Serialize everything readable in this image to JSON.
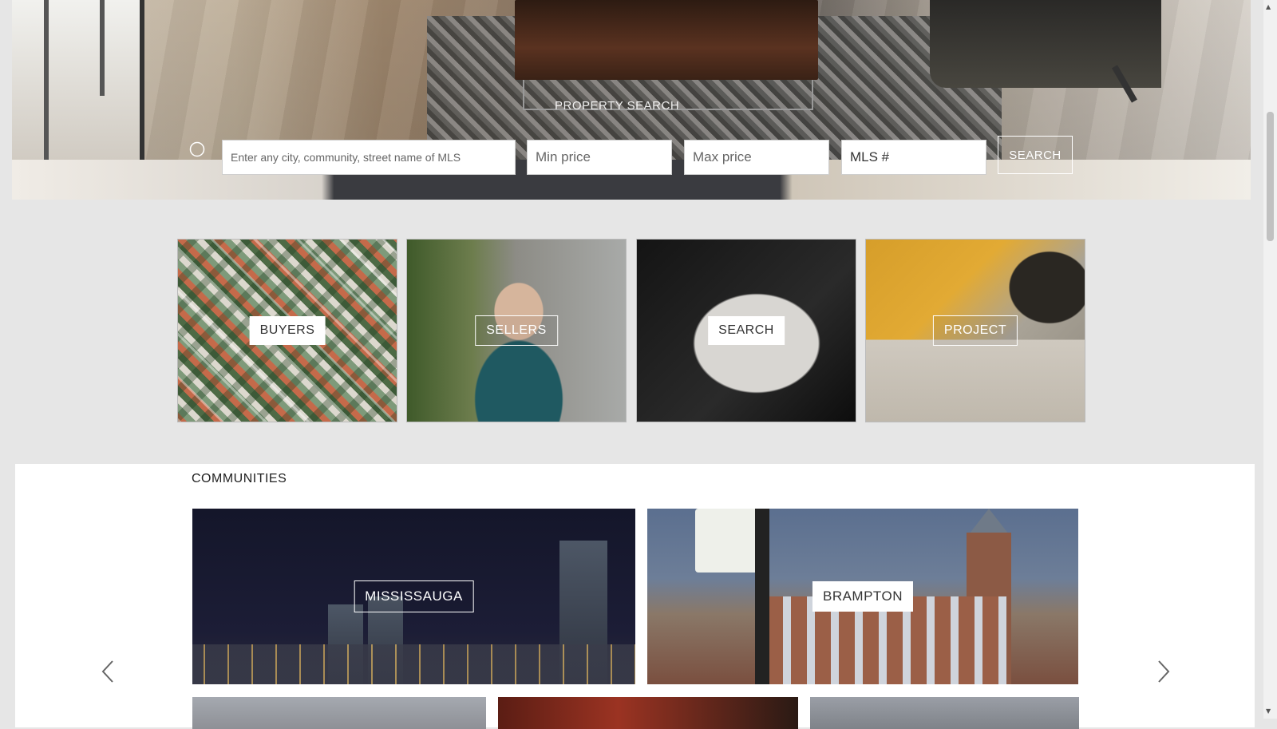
{
  "hero": {
    "title": "PROPERTY SEARCH",
    "search_placeholder": "Enter any city, community, street name of MLS",
    "min_price_placeholder": "Min price",
    "max_price_placeholder": "Max price",
    "mls_placeholder": "MLS #",
    "search_button": "SEARCH"
  },
  "categories": [
    {
      "label": "BUYERS"
    },
    {
      "label": "SELLERS"
    },
    {
      "label": "SEARCH"
    },
    {
      "label": "PROJECT"
    }
  ],
  "communities": {
    "title": "COMMUNITIES",
    "items": [
      {
        "label": "MISSISSAUGA"
      },
      {
        "label": "BRAMPTON"
      }
    ]
  }
}
